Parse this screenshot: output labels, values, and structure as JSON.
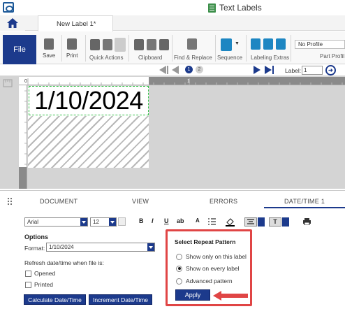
{
  "window": {
    "title": "Text Labels"
  },
  "tabs": {
    "document_tab": "New Label 1*"
  },
  "ribbon": {
    "file": "File",
    "save": "Save",
    "print": "Print",
    "quick_actions": "Quick Actions",
    "clipboard": "Clipboard",
    "find_replace": "Find & Replace",
    "sequence": "Sequence",
    "labeling_extras": "Labeling Extras",
    "profile_value": "No Profile",
    "part_profile": "Part Profil"
  },
  "nav": {
    "page_1": "1",
    "page_2": "2",
    "label_caption": "Label:",
    "label_value": "1"
  },
  "ruler": {
    "mark_0": "0",
    "mark_1": "1"
  },
  "canvas": {
    "date_text": "1/10/2024"
  },
  "panel_tabs": {
    "document": "DOCUMENT",
    "view": "VIEW",
    "errors": "ERRORS",
    "datetime": "DATE/TIME 1"
  },
  "format_toolbar": {
    "font": "Arial",
    "size": "12",
    "bold": "B",
    "italic": "I",
    "underline": "U",
    "strike": "ab",
    "spacing": "A"
  },
  "options": {
    "title": "Options",
    "format_label": "Format:",
    "format_value": "1/10/2024",
    "refresh_label": "Refresh date/time when file is:",
    "opened": "Opened",
    "printed": "Printed",
    "calc_button": "Calculate Date/Time",
    "increment_button": "Increment Date/Time"
  },
  "repeat": {
    "title": "Select Repeat Pattern",
    "options": [
      "Show only on this label",
      "Show on every label",
      "Advanced pattern"
    ],
    "selected_index": 1,
    "apply": "Apply"
  },
  "colors": {
    "accent": "#1c3a8c",
    "highlight": "#e04545",
    "selection": "#37c04a"
  }
}
